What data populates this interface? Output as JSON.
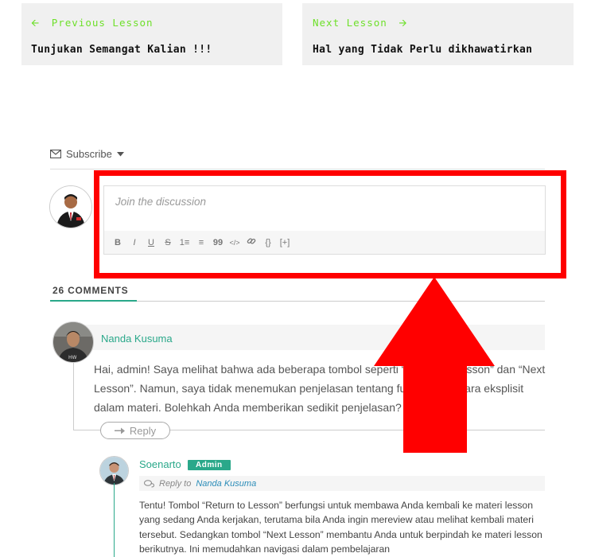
{
  "lesson_nav": {
    "previous": {
      "direction_label": "Previous Lesson",
      "title": "Tunjukan Semangat Kalian !!!"
    },
    "next": {
      "direction_label": "Next Lesson",
      "title": "Hal yang Tidak Perlu dikhawatirkan"
    }
  },
  "discussion": {
    "subscribe_label": "Subscribe",
    "editor_placeholder": "Join the discussion",
    "toolbar": [
      "B",
      "I",
      "U",
      "S",
      "1≡",
      "≡",
      "99",
      "</>",
      "🔗",
      "{}",
      "[+]"
    ]
  },
  "comments": {
    "count_label": "26 COMMENTS",
    "items": [
      {
        "author": "Nanda Kusuma",
        "text": "Hai, admin! Saya melihat bahwa ada beberapa tombol seperti “Return to Lesson” dan “Next Lesson”. Namun, saya tidak menemukan penjelasan tentang fungsinya secara eksplisit dalam materi. Bolehkah Anda memberikan sedikit penjelasan?",
        "reply_label": "Reply"
      }
    ],
    "reply": {
      "author": "Soenarto",
      "badge": "Admin",
      "reply_to_label": "Reply to",
      "reply_to_name": "Nanda Kusuma",
      "text": "Tentu! Tombol “Return to Lesson” berfungsi untuk membawa Anda kembali ke materi lesson yang sedang Anda kerjakan, terutama bila Anda ingin mereview atau melihat kembali materi tersebut. Sedangkan tombol “Next Lesson” membantu Anda untuk berpindah ke materi lesson berikutnya. Ini memudahkan navigasi dalam pembelajaran"
    }
  },
  "colors": {
    "accent_green": "#2aa88a",
    "nav_green": "#6ee02a",
    "annotation_red": "#ff0000"
  }
}
